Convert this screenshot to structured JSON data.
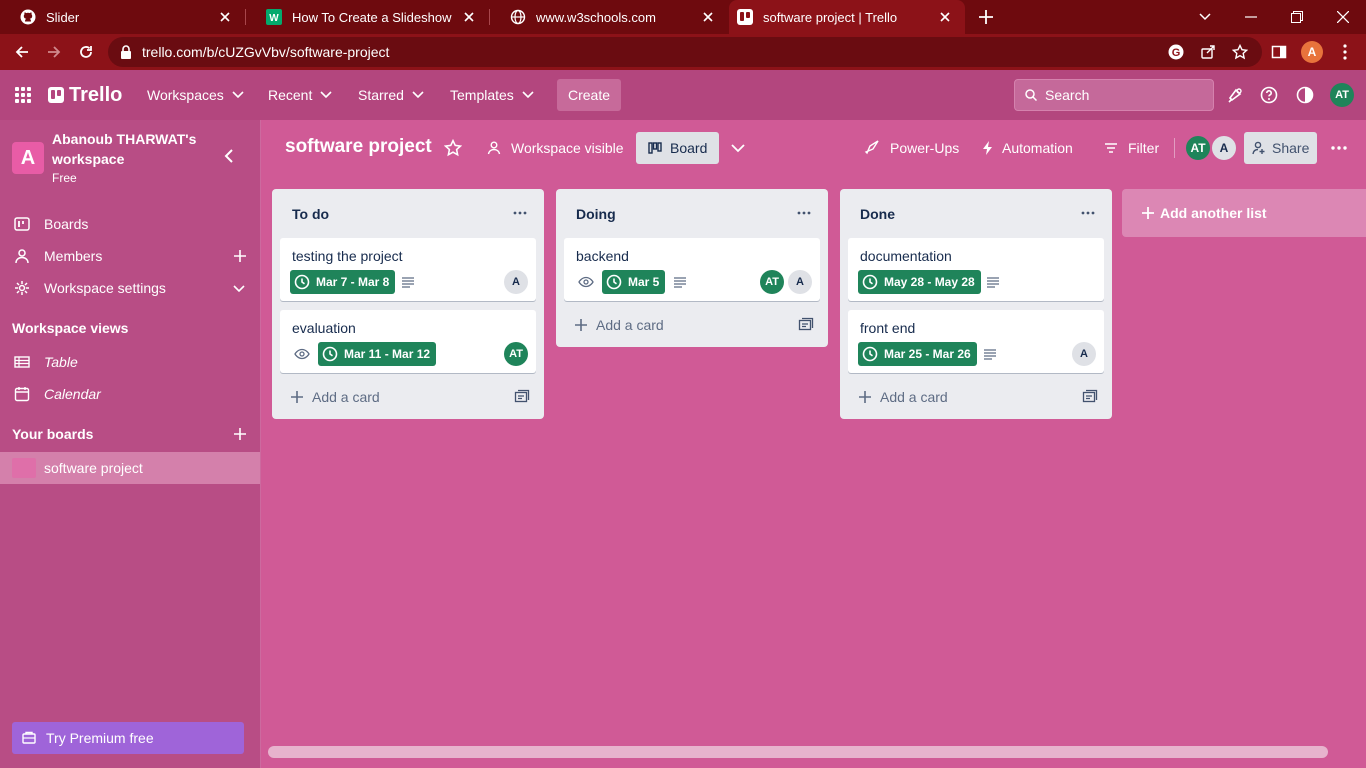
{
  "browser": {
    "tabs": [
      {
        "title": "Slider",
        "icon": "github-icon"
      },
      {
        "title": "How To Create a Slideshow",
        "icon": "w3schools-icon"
      },
      {
        "title": "www.w3schools.com",
        "icon": "globe-icon"
      },
      {
        "title": "software project | Trello",
        "icon": "trello-icon",
        "active": true
      }
    ],
    "url": "trello.com/b/cUZGvVbv/software-project",
    "profile_initial": "A"
  },
  "header": {
    "logo": "Trello",
    "menus": [
      "Workspaces",
      "Recent",
      "Starred",
      "Templates"
    ],
    "create_label": "Create",
    "search_placeholder": "Search",
    "user_initials": "AT"
  },
  "sidebar": {
    "workspace_initial": "A",
    "workspace_name": "Abanoub THARWAT's workspace",
    "plan": "Free",
    "items": [
      {
        "label": "Boards",
        "icon": "board-icon"
      },
      {
        "label": "Members",
        "icon": "person-icon"
      },
      {
        "label": "Workspace settings",
        "icon": "gear-icon"
      }
    ],
    "views_heading": "Workspace views",
    "views": [
      {
        "label": "Table",
        "icon": "table-icon"
      },
      {
        "label": "Calendar",
        "icon": "calendar-icon"
      }
    ],
    "boards_heading": "Your boards",
    "boards": [
      "software project"
    ],
    "premium_label": "Try Premium free"
  },
  "board": {
    "title": "software project",
    "visibility": "Workspace visible",
    "view": "Board",
    "powerups": "Power-Ups",
    "automation": "Automation",
    "filter": "Filter",
    "members": [
      "AT",
      "A"
    ],
    "share": "Share",
    "add_list": "Add another list",
    "add_card": "Add a card",
    "lists": [
      {
        "title": "To do",
        "cards": [
          {
            "title": "testing the project",
            "due": "Mar 7 - Mar 8",
            "members": [
              "A"
            ]
          },
          {
            "title": "evaluation",
            "due": "Mar 11 - Mar 12",
            "members": [
              "AT"
            ]
          }
        ]
      },
      {
        "title": "Doing",
        "cards": [
          {
            "title": "backend",
            "due": "Mar 5",
            "members": [
              "AT",
              "A"
            ]
          }
        ]
      },
      {
        "title": "Done",
        "cards": [
          {
            "title": "documentation",
            "due": "May 28 - May 28"
          },
          {
            "title": "front end",
            "due": "Mar 25 - Mar 26",
            "members": [
              "A"
            ]
          }
        ]
      }
    ]
  },
  "colors": {
    "board_background": "#d05a96",
    "header": "#b3467e",
    "sidebar": "#b84d85",
    "due_badge": "#1f845a",
    "browser_frame": "#8c1218",
    "premium": "#9f64d9"
  }
}
